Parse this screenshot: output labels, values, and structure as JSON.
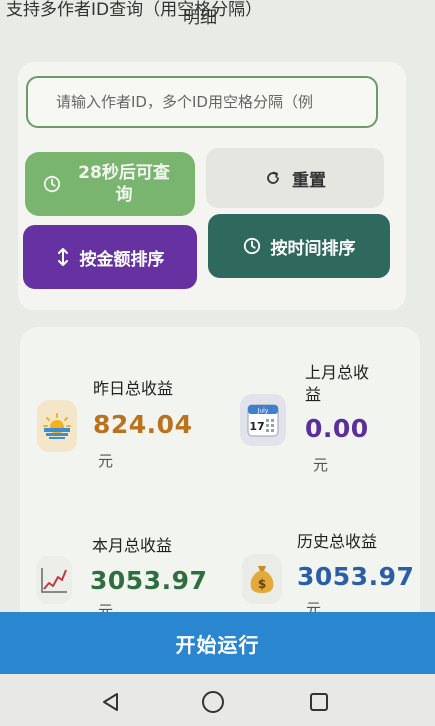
{
  "header": {
    "title_line1": "支持多作者ID查询（用空格分隔）",
    "title_line2": "明细"
  },
  "search": {
    "placeholder": "请输入作者ID，多个ID用空格分隔（例"
  },
  "buttons": {
    "query_label": "28秒后可查询",
    "reset_label": "重置",
    "sort_amount_label": "按金额排序",
    "sort_time_label": "按时间排序"
  },
  "stats": {
    "yesterday": {
      "label": "昨日总收益",
      "value": "824.04",
      "unit": "元",
      "icon": "sunrise-icon",
      "color": "#b9731e"
    },
    "last_month": {
      "label_line1": "上月总收",
      "label_line2": "益",
      "value": "0.00",
      "unit": "元",
      "icon": "calendar-icon",
      "calendar_month": "July",
      "calendar_day": "17",
      "color": "#5a2f9a"
    },
    "this_month": {
      "label": "本月总收益",
      "value": "3053.97",
      "unit": "元",
      "icon": "chart-icon",
      "color": "#2f6e3e"
    },
    "history": {
      "label": "历史总收益",
      "value": "3053.97",
      "unit": "元",
      "icon": "money-bag-icon",
      "color": "#2a5fa8"
    }
  },
  "start": {
    "label": "开始运行"
  }
}
